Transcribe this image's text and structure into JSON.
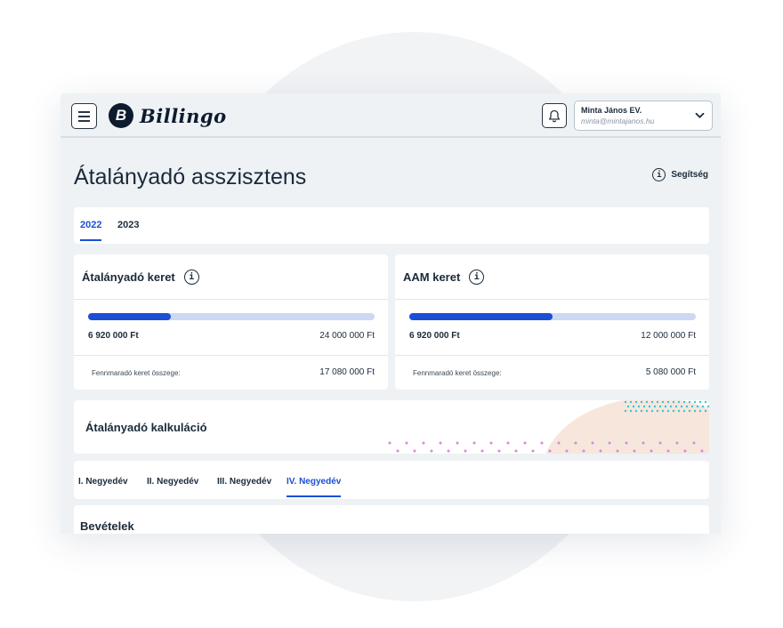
{
  "app": {
    "logo_letter": "B",
    "logo_text": "Billingo"
  },
  "user": {
    "name": "Minta János EV.",
    "email": "minta@mintajanos.hu"
  },
  "page": {
    "title": "Átalányadó asszisztens",
    "help_label": "Segítség"
  },
  "year_tabs": [
    {
      "label": "2022",
      "active": true
    },
    {
      "label": "2023",
      "active": false
    }
  ],
  "cards": [
    {
      "title": "Átalányadó keret",
      "used": "6 920 000 Ft",
      "total": "24 000 000 Ft",
      "progress": 0.288,
      "remaining_label": "Fennmaradó keret összege:",
      "remaining": "17 080 000 Ft"
    },
    {
      "title": "AAM keret",
      "used": "6 920 000 Ft",
      "total": "12 000 000 Ft",
      "progress": 0.5,
      "remaining_label": "Fennmaradó keret összege:",
      "remaining": "5 080 000 Ft"
    }
  ],
  "calc": {
    "title": "Átalányadó kalkuláció"
  },
  "quarter_tabs": [
    {
      "label": "I. Negyedév",
      "active": false
    },
    {
      "label": "II. Negyedév",
      "active": false
    },
    {
      "label": "III. Negyedév",
      "active": false
    },
    {
      "label": "IV. Negyedév",
      "active": true
    }
  ],
  "revenue": {
    "title": "Bevételek"
  },
  "colors": {
    "accent": "#1a4fd6",
    "track": "#cdd8f2",
    "dots_pink": "#d58bd8",
    "dots_cyan": "#39c3d6",
    "blob": "#f7e6dc"
  }
}
